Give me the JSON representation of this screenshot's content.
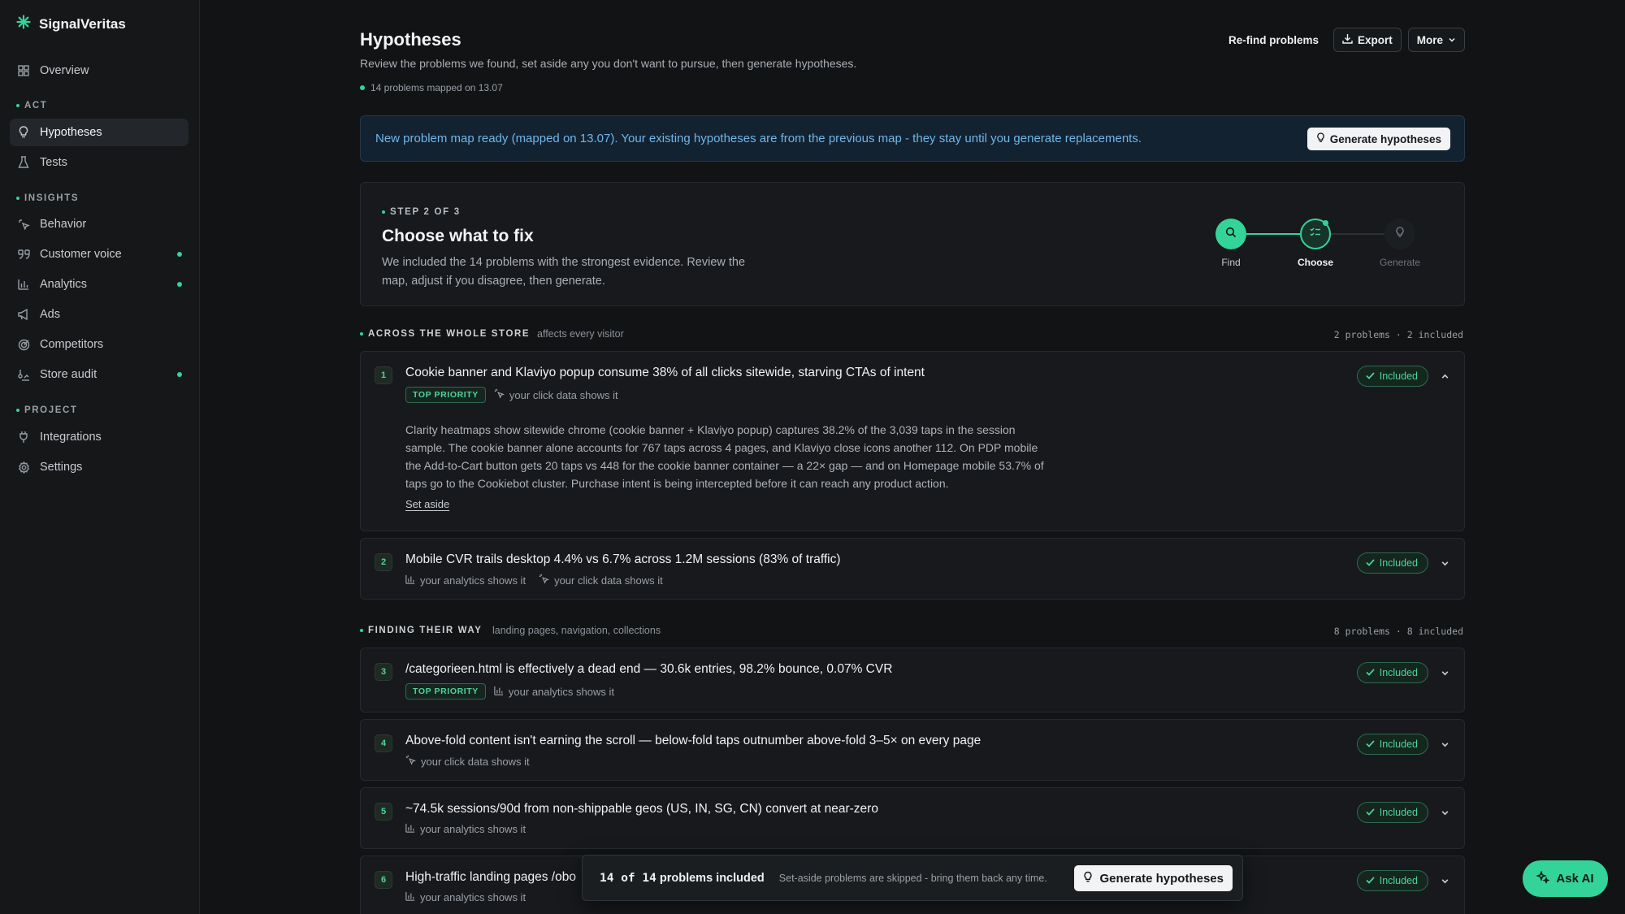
{
  "app": {
    "name": "SignalVeritas"
  },
  "sidebar": {
    "overview": "Overview",
    "sections": [
      {
        "label": "ACT",
        "items": [
          {
            "label": "Hypotheses"
          },
          {
            "label": "Tests"
          }
        ]
      },
      {
        "label": "INSIGHTS",
        "items": [
          {
            "label": "Behavior"
          },
          {
            "label": "Customer voice"
          },
          {
            "label": "Analytics"
          },
          {
            "label": "Ads"
          },
          {
            "label": "Competitors"
          },
          {
            "label": "Store audit"
          }
        ]
      },
      {
        "label": "PROJECT",
        "items": [
          {
            "label": "Integrations"
          },
          {
            "label": "Settings"
          }
        ]
      }
    ],
    "accent": "#34d399"
  },
  "header": {
    "title": "Hypotheses",
    "subtitle": "Review the problems we found, set aside any you don't want to pursue, then generate hypotheses.",
    "mapped": "14 problems mapped on 13.07",
    "refind": "Re-find problems",
    "export": "Export",
    "more": "More"
  },
  "banner": {
    "text": "New problem map ready (mapped on 13.07). Your existing hypotheses are from the previous map - they stay until you generate replacements.",
    "button": "Generate hypotheses"
  },
  "step": {
    "label": "STEP 2 OF 3",
    "title": "Choose what to fix",
    "desc": "We included the 14 problems with the strongest evidence. Review the map, adjust if you disagree, then generate.",
    "steps": [
      {
        "name": "Find"
      },
      {
        "name": "Choose"
      },
      {
        "name": "Generate"
      }
    ]
  },
  "groups": [
    {
      "title": "ACROSS THE WHOLE STORE",
      "sub": "affects every visitor",
      "count": "2 problems · 2 included"
    },
    {
      "title": "FINDING THEIR WAY",
      "sub": "landing pages, navigation, collections",
      "count": "8 problems · 8 included"
    }
  ],
  "problems": [
    {
      "num": "1",
      "title": "Cookie banner and Klaviyo popup consume 38% of all clicks sitewide, starving CTAs of intent",
      "badge": "TOP PRIORITY",
      "sources": [
        "your click data shows it"
      ],
      "status": "Included",
      "body": "Clarity heatmaps show sitewide chrome (cookie banner + Klaviyo popup) captures 38.2% of the 3,039 taps in the session sample. The cookie banner alone accounts for 767 taps across 4 pages, and Klaviyo close icons another 112. On PDP mobile the Add-to-Cart button gets 20 taps vs 448 for the cookie banner container — a 22× gap — and on Homepage mobile 53.7% of taps go to the Cookiebot cluster. Purchase intent is being intercepted before it can reach any product action.",
      "set_aside": "Set aside"
    },
    {
      "num": "2",
      "title": "Mobile CVR trails desktop 4.4% vs 6.7% across 1.2M sessions (83% of traffic)",
      "sources": [
        "your analytics shows it",
        "your click data shows it"
      ],
      "status": "Included"
    },
    {
      "num": "3",
      "title": "/categorieen.html is effectively a dead end — 30.6k entries, 98.2% bounce, 0.07% CVR",
      "badge": "TOP PRIORITY",
      "sources": [
        "your analytics shows it"
      ],
      "status": "Included"
    },
    {
      "num": "4",
      "title": "Above-fold content isn't earning the scroll — below-fold taps outnumber above-fold 3–5× on every page",
      "sources": [
        "your click data shows it"
      ],
      "status": "Included"
    },
    {
      "num": "5",
      "title": "~74.5k sessions/90d from non-shippable geos (US, IN, SG, CN) convert at near-zero",
      "sources": [
        "your analytics shows it"
      ],
      "status": "Included"
    },
    {
      "num": "6",
      "title": "High-traffic landing pages /obo",
      "sources": [
        "your analytics shows it"
      ],
      "status": "Included"
    }
  ],
  "floatbar": {
    "count": "14 of 14",
    "count_suffix": "problems included",
    "note": "Set-aside problems are skipped - bring them back any time.",
    "button": "Generate hypotheses"
  },
  "ask_ai": "Ask AI"
}
